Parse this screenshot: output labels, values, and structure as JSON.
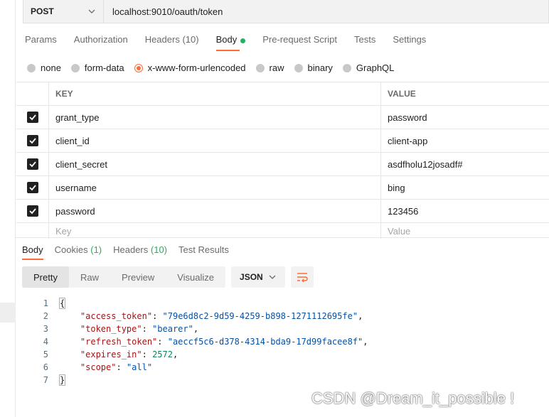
{
  "request": {
    "method": "POST",
    "url": "localhost:9010/oauth/token"
  },
  "tabs": [
    {
      "label": "Params"
    },
    {
      "label": "Authorization"
    },
    {
      "label": "Headers",
      "count": "(10)"
    },
    {
      "label": "Body",
      "active": true
    },
    {
      "label": "Pre-request Script"
    },
    {
      "label": "Tests"
    },
    {
      "label": "Settings"
    }
  ],
  "body_types": [
    {
      "label": "none"
    },
    {
      "label": "form-data"
    },
    {
      "label": "x-www-form-urlencoded",
      "selected": true
    },
    {
      "label": "raw"
    },
    {
      "label": "binary"
    },
    {
      "label": "GraphQL"
    }
  ],
  "kv": {
    "key_header": "KEY",
    "value_header": "VALUE",
    "rows": [
      {
        "key": "grant_type",
        "value": "password"
      },
      {
        "key": "client_id",
        "value": "client-app"
      },
      {
        "key": "client_secret",
        "value": "asdfholu12josadf#"
      },
      {
        "key": "username",
        "value": "bing"
      },
      {
        "key": "password",
        "value": "123456"
      }
    ],
    "key_placeholder": "Key",
    "value_placeholder": "Value"
  },
  "response": {
    "tabs": {
      "body": "Body",
      "cookies": "Cookies",
      "cookies_count": "(1)",
      "headers": "Headers",
      "headers_count": "(10)",
      "test_results": "Test Results"
    },
    "views": [
      "Pretty",
      "Raw",
      "Preview",
      "Visualize"
    ],
    "language": "JSON",
    "lines": [
      {
        "n": "1",
        "open": "{"
      },
      {
        "n": "2",
        "key": "\"access_token\"",
        "val": "\"79e6d8c2-9d59-4259-b898-1271112695fe\"",
        "type": "s",
        "comma": ","
      },
      {
        "n": "3",
        "key": "\"token_type\"",
        "val": "\"bearer\"",
        "type": "s",
        "comma": ","
      },
      {
        "n": "4",
        "key": "\"refresh_token\"",
        "val": "\"aeccf5c6-d378-4314-bda9-17d99facee8f\"",
        "type": "s",
        "comma": ","
      },
      {
        "n": "5",
        "key": "\"expires_in\"",
        "val": "2572",
        "type": "n",
        "comma": ","
      },
      {
        "n": "6",
        "key": "\"scope\"",
        "val": "\"all\"",
        "type": "s",
        "comma": ""
      },
      {
        "n": "7",
        "close": "}"
      }
    ]
  },
  "watermark": "CSDN @Dream_it_possible !",
  "colors": {
    "accent": "#ff6c37",
    "active_dot": "#27ae60"
  }
}
